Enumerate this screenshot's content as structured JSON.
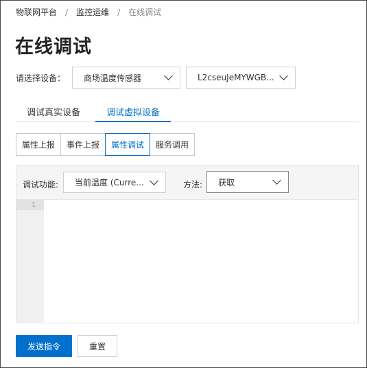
{
  "breadcrumb": {
    "items": [
      "物联网平台",
      "监控运维",
      "在线调试"
    ],
    "separator": "/"
  },
  "page": {
    "title": "在线调试"
  },
  "device_selector": {
    "label": "请选择设备：",
    "product_value": "商场温度传感器",
    "device_value": "L2cseuJeMYWGB..."
  },
  "tabs": [
    {
      "label": "调试真实设备",
      "active": false
    },
    {
      "label": "调试虚拟设备",
      "active": true
    }
  ],
  "segments": [
    {
      "label": "属性上报",
      "active": false
    },
    {
      "label": "事件上报",
      "active": false
    },
    {
      "label": "属性调试",
      "active": true
    },
    {
      "label": "服务调用",
      "active": false
    }
  ],
  "debug": {
    "function_label": "调试功能:",
    "function_value": "当前温度 (Curre...",
    "method_label": "方法:",
    "method_value": "获取",
    "line_number": "1"
  },
  "actions": {
    "send_label": "发送指令",
    "reset_label": "重置"
  },
  "colors": {
    "accent": "#0070cc",
    "panel_bg": "#f5f5f5"
  }
}
